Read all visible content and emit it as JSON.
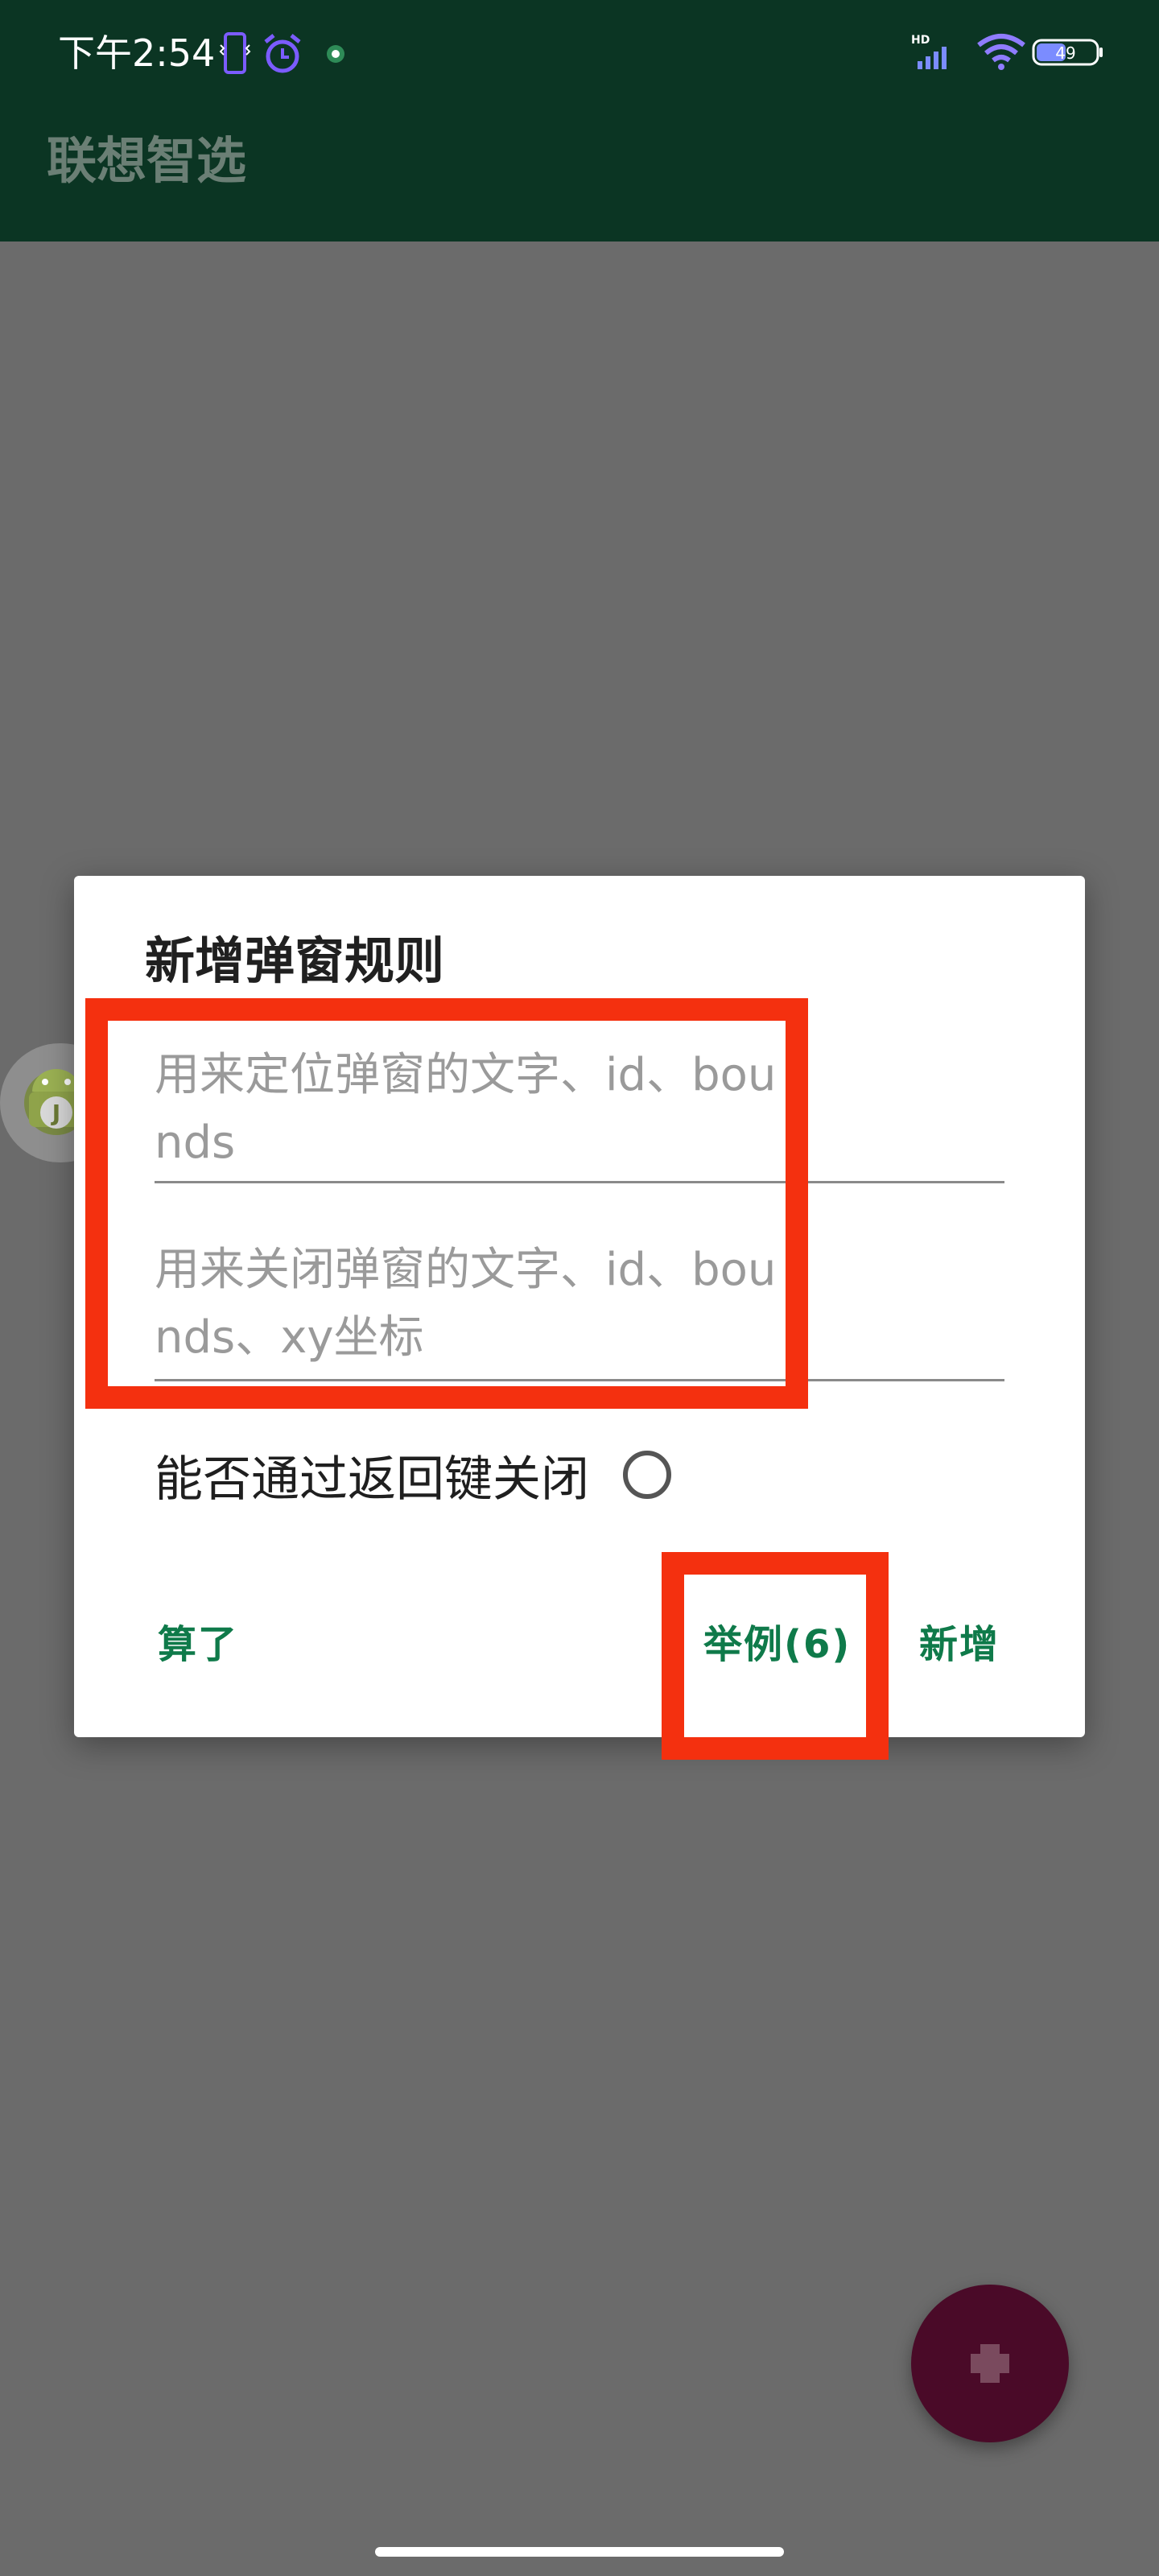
{
  "status_bar": {
    "time": "下午2:54",
    "battery_level": "49",
    "icons": [
      "phone-vibrate-icon",
      "alarm-icon",
      "app-notification-icon",
      "hd-signal-icon",
      "wifi-icon",
      "battery-icon"
    ]
  },
  "app_bar": {
    "title": "联想智选"
  },
  "dialog": {
    "title": "新增弹窗规则",
    "locate_input": {
      "value": "",
      "placeholder": "用来定位弹窗的文字、id、bounds"
    },
    "close_input": {
      "value": "",
      "placeholder": "用来关闭弹窗的文字、id、bounds、xy坐标"
    },
    "back_key_toggle": {
      "label": "能否通过返回键关闭",
      "checked": false
    },
    "buttons": {
      "cancel": "算了",
      "example": "举例(6)",
      "add": "新增"
    }
  },
  "fab": {
    "icon": "plus-icon"
  },
  "colors": {
    "app_bar": "#0b3523",
    "scrim_background": "#6b6b6b",
    "dialog_button": "#0f7a4a",
    "highlight": "#f4300f",
    "fab": "#4a0a28"
  }
}
